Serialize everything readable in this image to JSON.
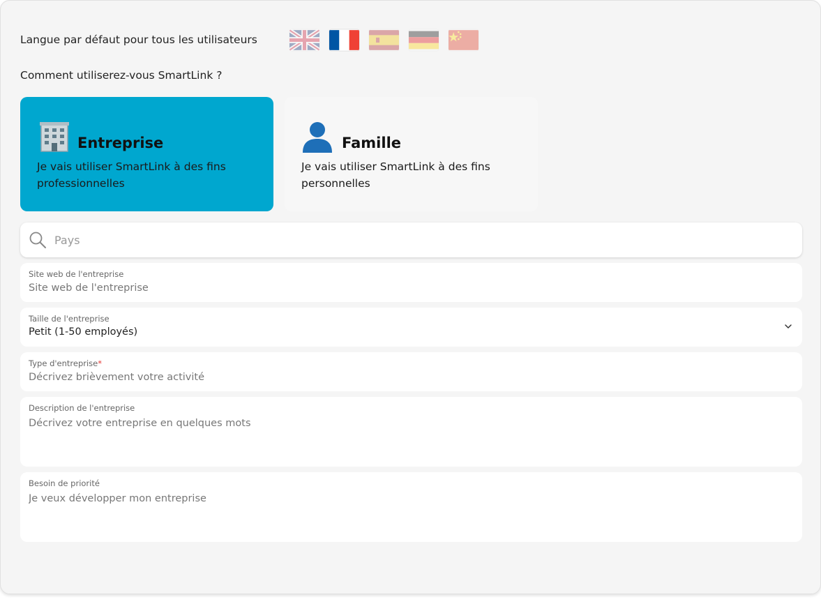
{
  "language": {
    "label": "Langue par défaut pour tous les utilisateurs",
    "flags": [
      {
        "name": "uk-flag-icon",
        "active": false
      },
      {
        "name": "fr-flag-icon",
        "active": true
      },
      {
        "name": "es-flag-icon",
        "active": false
      },
      {
        "name": "de-flag-icon",
        "active": false
      },
      {
        "name": "cn-flag-icon",
        "active": false
      }
    ]
  },
  "usage": {
    "question": "Comment utiliserez-vous SmartLink ?",
    "options": [
      {
        "title": "Entreprise",
        "description": "Je vais utiliser SmartLink à des fins professionnelles",
        "icon": "office-building-icon",
        "selected": true
      },
      {
        "title": "Famille",
        "description": "Je vais utiliser SmartLink à des fins personnelles",
        "icon": "person-icon",
        "selected": false
      }
    ]
  },
  "search": {
    "placeholder": "Pays",
    "icon": "search-icon"
  },
  "fields": {
    "website": {
      "label": "Site web de l'entreprise",
      "placeholder": "Site web de l'entreprise"
    },
    "size": {
      "label": "Taille de l'entreprise",
      "value": "Petit (1-50 employés)"
    },
    "type": {
      "label": "Type d'entreprise",
      "required_mark": "*",
      "placeholder": "Décrivez brièvement votre activité"
    },
    "description": {
      "label": "Description de l'entreprise",
      "placeholder": "Décrivez votre entreprise en quelques mots"
    },
    "priority": {
      "label": "Besoin de priorité",
      "placeholder": "Je veux développer mon entreprise"
    }
  },
  "colors": {
    "accent": "#00a7cf",
    "panel": "#f5f5f5",
    "required": "#e53935"
  }
}
